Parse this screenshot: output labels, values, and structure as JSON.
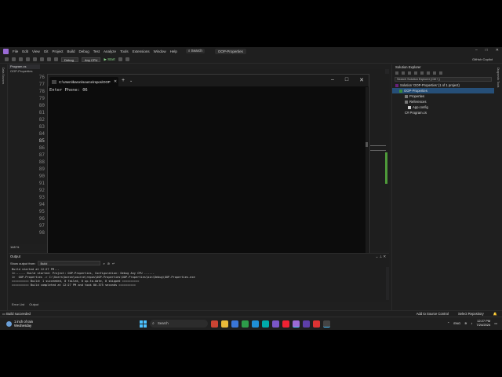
{
  "menu": {
    "items": [
      "File",
      "Edit",
      "View",
      "Git",
      "Project",
      "Build",
      "Debug",
      "Test",
      "Analyze",
      "Tools",
      "Extensions",
      "Window",
      "Help"
    ],
    "search_label": "Search",
    "project_title": "OOP-Properties"
  },
  "toolbar": {
    "config": "Debug",
    "platform": "Any CPU",
    "start_label": "Start",
    "copilot_label": "GitHub Copilot"
  },
  "editor": {
    "file_tab": "Program.cs",
    "breadcrumb": "OOP-Properties",
    "line_numbers": [
      "76",
      "77",
      "78",
      "79",
      "80",
      "81",
      "82",
      "83",
      "84",
      "85",
      "86",
      "87",
      "88",
      "89",
      "90",
      "91",
      "92",
      "93",
      "94",
      "95",
      "96",
      "97",
      "98"
    ],
    "active_line": "85",
    "zoom": "148 %"
  },
  "left_strip_label": "Data Sources",
  "right_strip_label": "Diagnostic Tools",
  "terminal": {
    "tab_title": "C:\\Users\\baron\\source\\repos\\OOP",
    "output_line": "Enter Phone: 06"
  },
  "solution_explorer": {
    "header": "Solution Explorer",
    "search_placeholder": "Search Solution Explorer (Ctrl+;)",
    "solution": "Solution 'OOP-Properties' (1 of 1 project)",
    "project": "OOP-Properties",
    "items": [
      "Properties",
      "References",
      "App.config",
      "C# Program.cs"
    ],
    "tab_solution": "Solution Explorer",
    "tab_git": "Git Changes"
  },
  "output": {
    "title": "Output",
    "show_from_label": "Show output from:",
    "source": "Build",
    "lines": [
      "Build started at 12:27 PM...",
      "1>------ Build started: Project: OOP-Properties, Configuration: Debug Any CPU ------",
      "1>  OOP-Properties -> C:\\Users\\baron\\source\\repos\\OOP-Properties\\OOP-Properties\\bin\\Debug\\OOP-Properties.exe",
      "========== Build: 1 succeeded, 0 failed, 0 up-to-date, 0 skipped ==========",
      "========== Build completed at 12:27 PM and took 00.375 seconds =========="
    ],
    "tab_error_list": "Error List",
    "tab_output": "Output"
  },
  "statusbar": {
    "status": "Build succeeded",
    "add_source_control": "Add to Source Control",
    "select_repository": "Select Repository"
  },
  "taskbar": {
    "weather_line1": "1 inch of rain",
    "weather_line2": "Wednesday",
    "search_label": "Search",
    "lang": "ENG",
    "time": "12:27 PM",
    "date": "7/24/2024"
  },
  "colors": {
    "accent": "#4cc2ff",
    "vs_purple": "#9b6bd6",
    "selection": "#264f78"
  }
}
